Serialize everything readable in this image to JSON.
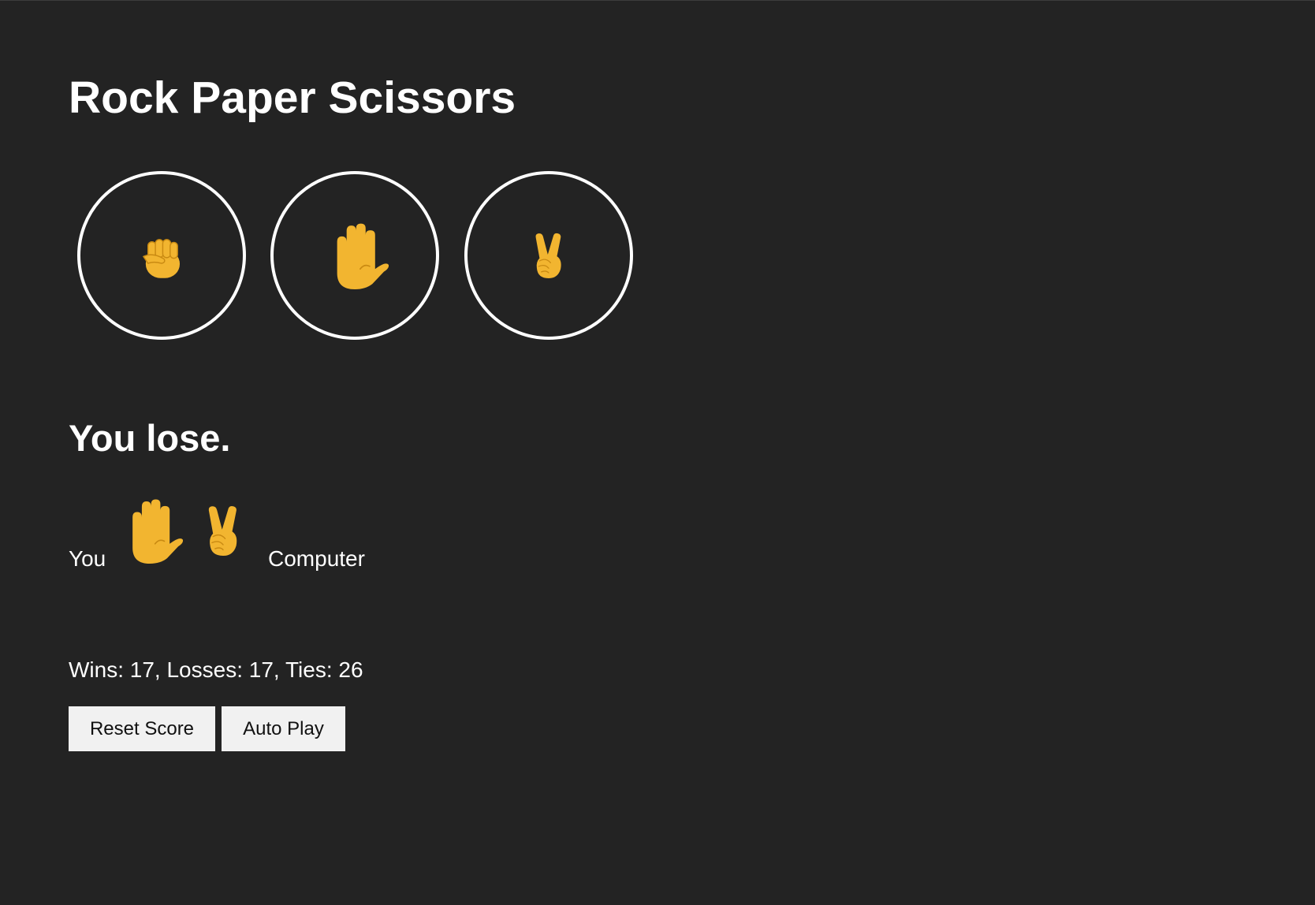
{
  "title": "Rock Paper Scissors",
  "choices": [
    {
      "move": "rock",
      "icon": "rock-fist-icon"
    },
    {
      "move": "paper",
      "icon": "paper-hand-icon"
    },
    {
      "move": "scissors",
      "icon": "scissors-victory-icon"
    }
  ],
  "result": {
    "text": "You lose.",
    "player_label": "You",
    "computer_label": "Computer",
    "player_move_icon": "paper-hand-icon",
    "computer_move_icon": "scissors-victory-icon"
  },
  "score": {
    "text": "Wins: 17, Losses: 17, Ties: 26",
    "wins": 17,
    "losses": 17,
    "ties": 26
  },
  "buttons": {
    "reset": "Reset Score",
    "auto_play": "Auto Play"
  },
  "colors": {
    "background": "#232323",
    "text": "#ffffff",
    "emoji_skin": "#F2B530",
    "emoji_line": "#C98A12",
    "button_bg": "#f1f1f1"
  }
}
